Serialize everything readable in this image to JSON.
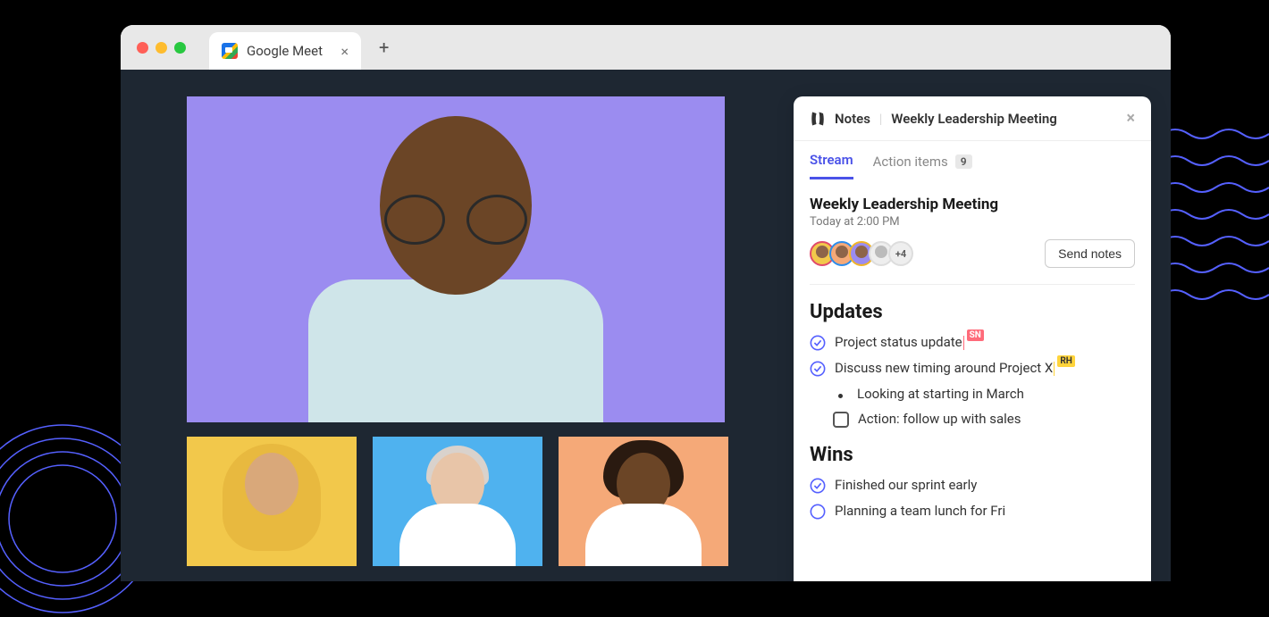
{
  "browser": {
    "tab_title": "Google Meet"
  },
  "notes": {
    "panel_label": "Notes",
    "meeting_name": "Weekly Leadership Meeting",
    "tabs": {
      "stream": "Stream",
      "action_items": "Action items",
      "action_count": "9"
    },
    "header": {
      "title": "Weekly Leadership Meeting",
      "time": "Today at 2:00 PM",
      "more_count": "+4",
      "send_button": "Send notes"
    },
    "sections": {
      "updates": {
        "title": "Updates",
        "items": [
          {
            "text": "Project status update",
            "tag": "SN"
          },
          {
            "text": "Discuss new timing around Project X",
            "tag": "RH"
          }
        ],
        "sub_bullet": "Looking at starting in March",
        "action": "Action: follow up with sales"
      },
      "wins": {
        "title": "Wins",
        "items": [
          {
            "text": "Finished our sprint early",
            "done": true
          },
          {
            "text": "Planning a team lunch for Fri",
            "done": false
          }
        ]
      }
    }
  }
}
